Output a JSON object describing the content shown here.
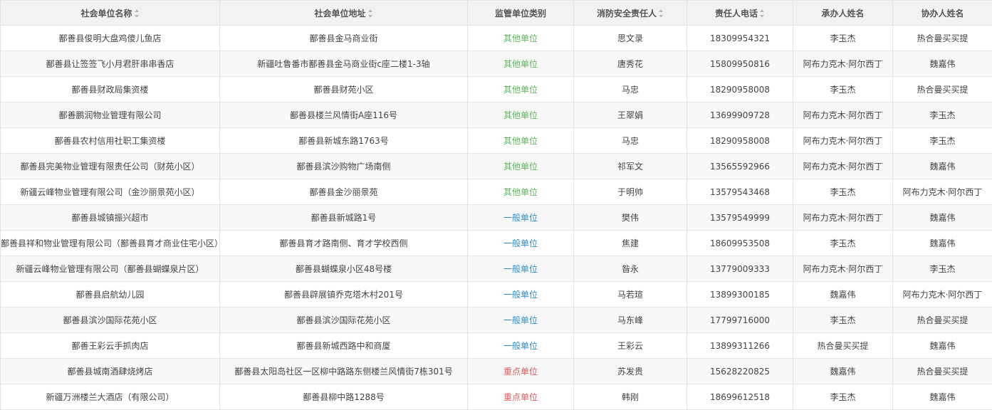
{
  "colors": {
    "other_unit": "#5cb85c",
    "general_unit": "#2a8fd0",
    "key_unit": "#e05a5a"
  },
  "table": {
    "headers": [
      {
        "label": "社会单位名称",
        "sortable": true,
        "icon": "sort-icon"
      },
      {
        "label": "社会单位地址",
        "sortable": true,
        "icon": "sort-icon"
      },
      {
        "label": "监管单位类别",
        "sortable": false
      },
      {
        "label": "消防安全责任人",
        "sortable": true,
        "icon": "sort-icon"
      },
      {
        "label": "责任人电话",
        "sortable": true,
        "icon": "sort-icon"
      },
      {
        "label": "承办人姓名",
        "sortable": false
      },
      {
        "label": "协办人姓名",
        "sortable": false
      }
    ],
    "rows": [
      {
        "name": "鄯善县俊明大盘鸡傻儿鱼店",
        "address": "鄯善县金马商业街",
        "category": "其他单位",
        "category_type": "other",
        "person": "思文录",
        "phone": "18309954321",
        "handler": "李玉杰",
        "assistant": "热合曼买买提"
      },
      {
        "name": "鄯善县让签签飞小月君肝串串香店",
        "address": "新疆吐鲁番市鄯善县金马商业街c座二楼1-3轴",
        "category": "其他单位",
        "category_type": "other",
        "person": "唐秀花",
        "phone": "15809950816",
        "handler": "阿布力克木·阿尔西丁",
        "assistant": "魏嘉伟"
      },
      {
        "name": "鄯善县财政局集资楼",
        "address": "鄯善县财苑小区",
        "category": "其他单位",
        "category_type": "other",
        "person": "马忠",
        "phone": "18290958008",
        "handler": "李玉杰",
        "assistant": "热合曼买买提"
      },
      {
        "name": "鄯善鹏润物业管理有限公司",
        "address": "鄯善县楼兰风情街A座116号",
        "category": "其他单位",
        "category_type": "other",
        "person": "王翠娟",
        "phone": "13699909728",
        "handler": "阿布力克木·阿尔西丁",
        "assistant": "李玉杰"
      },
      {
        "name": "鄯善县农村信用社职工集资楼",
        "address": "鄯善县新城东路1763号",
        "category": "其他单位",
        "category_type": "other",
        "person": "马忠",
        "phone": "18290958008",
        "handler": "阿布力克木·阿尔西丁",
        "assistant": "李玉杰"
      },
      {
        "name": "鄯善县完美物业管理有限责任公司（财苑小区）",
        "address": "鄯善县滨沙购物广场南侧",
        "category": "其他单位",
        "category_type": "other",
        "person": "祁军文",
        "phone": "13565592966",
        "handler": "阿布力克木·阿尔西丁",
        "assistant": "魏嘉伟"
      },
      {
        "name": "新疆云峰物业管理有限公司（金沙丽景苑小区）",
        "address": "鄯善县金沙丽景苑",
        "category": "其他单位",
        "category_type": "other",
        "person": "于明帅",
        "phone": "13579543468",
        "handler": "李玉杰",
        "assistant": "阿布力克木·阿尔西丁"
      },
      {
        "name": "鄯善县城镇振兴超市",
        "address": "鄯善县新城路1号",
        "category": "一般单位",
        "category_type": "general",
        "person": "樊伟",
        "phone": "13579549999",
        "handler": "阿布力克木·阿尔西丁",
        "assistant": "魏嘉伟"
      },
      {
        "name": "鄯善县祥和物业管理有限公司（鄯善县育才商业住宅小区）",
        "address": "鄯善县育才路南侧、育才学校西侧",
        "category": "一般单位",
        "category_type": "general",
        "person": "焦建",
        "phone": "18609953508",
        "handler": "李玉杰",
        "assistant": "魏嘉伟"
      },
      {
        "name": "新疆云峰物业管理有限公司（鄯善县蝴蝶泉片区）",
        "address": "鄯善县蝴蝶泉小区48号楼",
        "category": "一般单位",
        "category_type": "general",
        "person": "昝永",
        "phone": "13779009333",
        "handler": "阿布力克木·阿尔西丁",
        "assistant": "李玉杰"
      },
      {
        "name": "鄯善县启航幼儿园",
        "address": "鄯善县辟展镇乔克塔木村201号",
        "category": "一般单位",
        "category_type": "general",
        "person": "马若瑄",
        "phone": "13899300185",
        "handler": "魏嘉伟",
        "assistant": "阿布力克木·阿尔西丁"
      },
      {
        "name": "鄯善县滨沙国际花苑小区",
        "address": "鄯善县滨沙国际花苑小区",
        "category": "一般单位",
        "category_type": "general",
        "person": "马东峰",
        "phone": "17799716000",
        "handler": "李玉杰",
        "assistant": "热合曼买买提"
      },
      {
        "name": "鄯善王彩云手抓肉店",
        "address": "鄯善县新城西路中和商厦",
        "category": "一般单位",
        "category_type": "general",
        "person": "王彩云",
        "phone": "13899311266",
        "handler": "热合曼买买提",
        "assistant": "魏嘉伟"
      },
      {
        "name": "鄯善县城南酒肆烧烤店",
        "address": "鄯善县太阳岛社区一区柳中路路东侧楼兰风情街7栋301号",
        "category": "重点单位",
        "category_type": "key",
        "person": "苏发贵",
        "phone": "15628220825",
        "handler": "魏嘉伟",
        "assistant": "热合曼买买提"
      },
      {
        "name": "新疆万洲楼兰大酒店（有限公司）",
        "address": "鄯善县柳中路1288号",
        "category": "重点单位",
        "category_type": "key",
        "person": "韩刚",
        "phone": "18699612518",
        "handler": "李玉杰",
        "assistant": "魏嘉伟"
      }
    ]
  }
}
